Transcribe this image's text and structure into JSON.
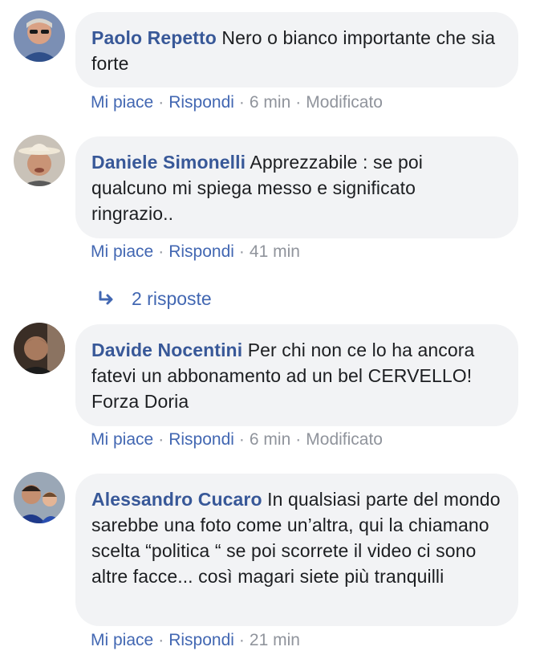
{
  "comments": [
    {
      "author": "Paolo Repetto",
      "text": "Nero o bianco importante che sia forte",
      "like": "Mi piace",
      "reply": "Rispondi",
      "time": "6 min",
      "edited": "Modificato",
      "avatar_icon": "avatar-man-sunglasses"
    },
    {
      "author": "Daniele Simonelli",
      "text": "Apprezzabile : se poi qualcuno mi spiega messo e significato ringrazio..",
      "like": "Mi piace",
      "reply": "Rispondi",
      "time": "41 min",
      "avatar_icon": "avatar-man-cowboy-hat"
    },
    {
      "author": "Davide Nocentini",
      "text": "Per chi non ce lo ha ancora fatevi un abbonamento ad un bel CERVELLO! Forza Doria",
      "like": "Mi piace",
      "reply": "Rispondi",
      "time": "6 min",
      "edited": "Modificato",
      "avatar_icon": "avatar-man-dark-background"
    },
    {
      "author": "Alessandro Cucaro",
      "text": "In qualsiasi parte del mondo sarebbe una foto come un’altra, qui la chiamano scelta “politica “ se poi scorrete il video ci sono altre facce... così magari siete più tranquilli",
      "like": "Mi piace",
      "reply": "Rispondi",
      "time": "21 min",
      "avatar_icon": "avatar-man-and-child"
    }
  ],
  "replies_link": {
    "label": "2 risposte",
    "icon": "reply-arrow-icon"
  },
  "colors": {
    "author": "#385898",
    "link": "#4267b2",
    "meta": "#90949c",
    "bubble": "#f2f3f5",
    "text": "#1c1e21"
  }
}
